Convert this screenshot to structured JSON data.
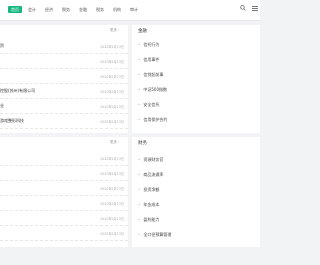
{
  "nav": {
    "items": [
      "首页",
      "会计",
      "经济",
      "税务",
      "金融",
      "税务",
      "机构",
      "审计"
    ]
  },
  "left_top": {
    "more": "更多 ›",
    "rows": [
      {
        "title": "贸",
        "date": "2020年2月13日"
      },
      {
        "title": "",
        "date": "2020年2月13日"
      },
      {
        "title": "",
        "date": "2020年2月13日"
      },
      {
        "title": "控股(苏州)有限公司",
        "date": "2020年2月13日"
      },
      {
        "title": "业",
        "date": "2020年2月13日"
      },
      {
        "title": "游戏整形科技",
        "date": "2020年2月13日"
      }
    ]
  },
  "right_top": {
    "title": "金融",
    "items": [
      "信托行为",
      "信用事件",
      "信贷起前事",
      "中证500指数",
      "安全信托",
      "信用保护合约"
    ]
  },
  "left_bot": {
    "more": "更多 ›",
    "rows": [
      {
        "title": "",
        "date": "2020年2月13日"
      },
      {
        "title": "",
        "date": "2020年2月13日"
      },
      {
        "title": "",
        "date": "2020年2月13日"
      },
      {
        "title": "",
        "date": "2020年2月13日"
      },
      {
        "title": "",
        "date": "2020年2月13日"
      },
      {
        "title": "",
        "date": "2020年2月13日"
      }
    ]
  },
  "right_bot": {
    "title": "财务",
    "items": [
      "资源财务官",
      "商品流通率",
      "投资净额",
      "年金成本",
      "盈利能力",
      "全口径预算管理"
    ]
  },
  "colors": {
    "accent": "#15b77e"
  }
}
